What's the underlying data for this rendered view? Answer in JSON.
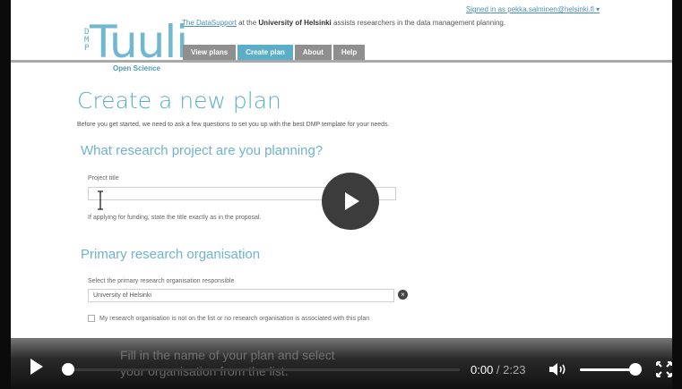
{
  "header": {
    "signed_in": "Signed in as pekka.salminen@helsinki.fi",
    "tagline_link": "The DataSupport",
    "tagline_mid": " at the ",
    "tagline_bold": "University of Helsinki",
    "tagline_end": " assists researchers in the data management planning.",
    "logo": {
      "word": "Tuuli",
      "dmp": "DMP",
      "sub": "Open Science"
    },
    "nav": [
      {
        "label": "View plans",
        "active": false
      },
      {
        "label": "Create plan",
        "active": true
      },
      {
        "label": "About",
        "active": false
      },
      {
        "label": "Help",
        "active": false
      }
    ]
  },
  "page": {
    "title": "Create a new plan",
    "intro": "Before you get started, we need to ask a few questions to set you up with the best DMP template for your needs.",
    "section1": {
      "heading": "What research project are you planning?",
      "label": "Project title",
      "value": "",
      "hint": "If applying for funding, state the title exactly as in the proposal."
    },
    "section2": {
      "heading": "Primary research organisation",
      "label": "Select the primary research organisation responsible",
      "value": "University of Helsinki",
      "clear_symbol": "×",
      "checkbox_label": "My research organisation is not on the list or no research organisation is associated with this plan"
    }
  },
  "video": {
    "caption_line1": "Fill in the name of your plan and select",
    "caption_line2": "your organisation from the list.",
    "current_time": "0:00",
    "separator": " / ",
    "duration": "2:23",
    "progress": 0,
    "volume": 1.0
  },
  "colors": {
    "accent": "#5aaec9",
    "nav_inactive": "#8f8f8f",
    "link": "#4a8fb6"
  }
}
